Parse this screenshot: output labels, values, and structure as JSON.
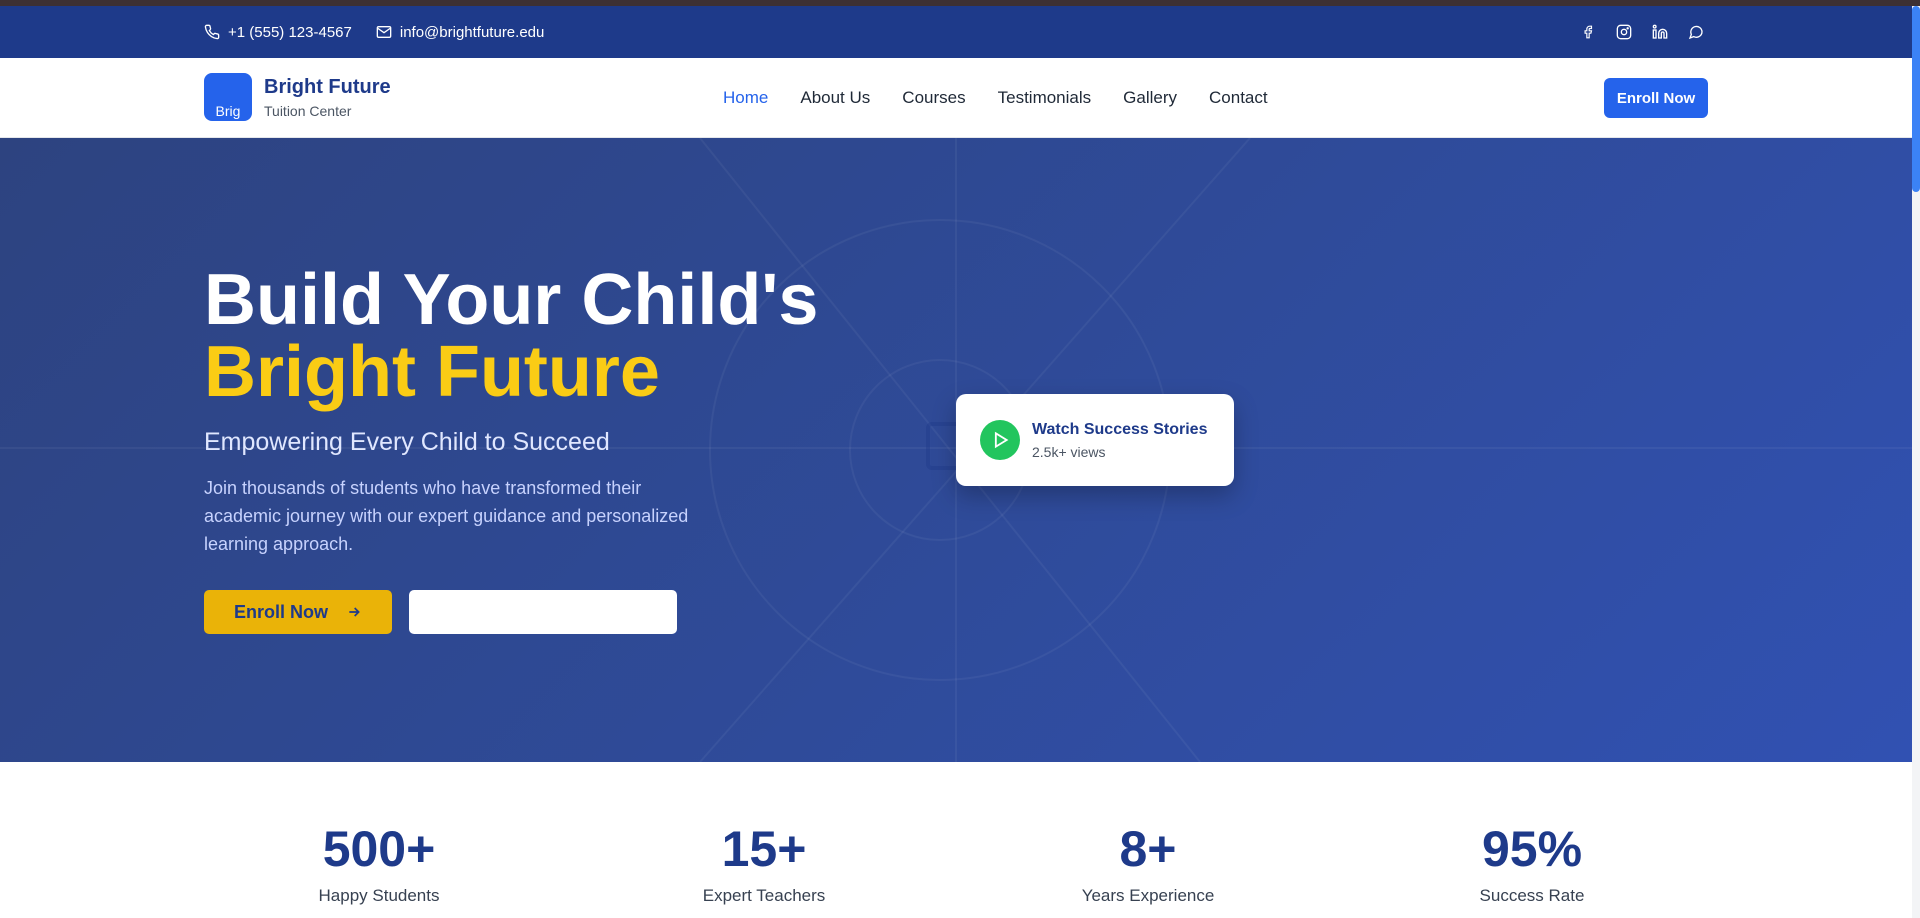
{
  "topbar": {
    "phone": "+1 (555) 123-4567",
    "email": "info@brightfuture.edu",
    "socials": [
      "facebook-icon",
      "instagram-icon",
      "linkedin-icon",
      "whatsapp-icon"
    ]
  },
  "navbar": {
    "logo_alt": "Brig",
    "brand_name": "Bright Future",
    "brand_sub": "Tuition Center",
    "menu": [
      "Home",
      "About Us",
      "Courses",
      "Testimonials",
      "Gallery",
      "Contact"
    ],
    "active": "Home",
    "enroll_label": "Enroll Now"
  },
  "hero": {
    "title_line1": "Build Your Child's",
    "title_line2": "Bright Future",
    "subtitle": "Empowering Every Child to Succeed",
    "description": "Join thousands of students who have transformed their academic journey with our expert guidance and personalized learning approach.",
    "enroll_label": "Enroll Now",
    "video_card": {
      "title": "Watch Success Stories",
      "views": "2.5k+ views"
    }
  },
  "stats": [
    {
      "value": "500+",
      "label": "Happy Students"
    },
    {
      "value": "15+",
      "label": "Expert Teachers"
    },
    {
      "value": "8+",
      "label": "Years Experience"
    },
    {
      "value": "95%",
      "label": "Success Rate"
    }
  ],
  "colors": {
    "primary": "#1e3a8a",
    "accent_blue": "#2563eb",
    "accent_yellow": "#facc15",
    "button_yellow": "#eab308",
    "play_green": "#22c55e"
  }
}
